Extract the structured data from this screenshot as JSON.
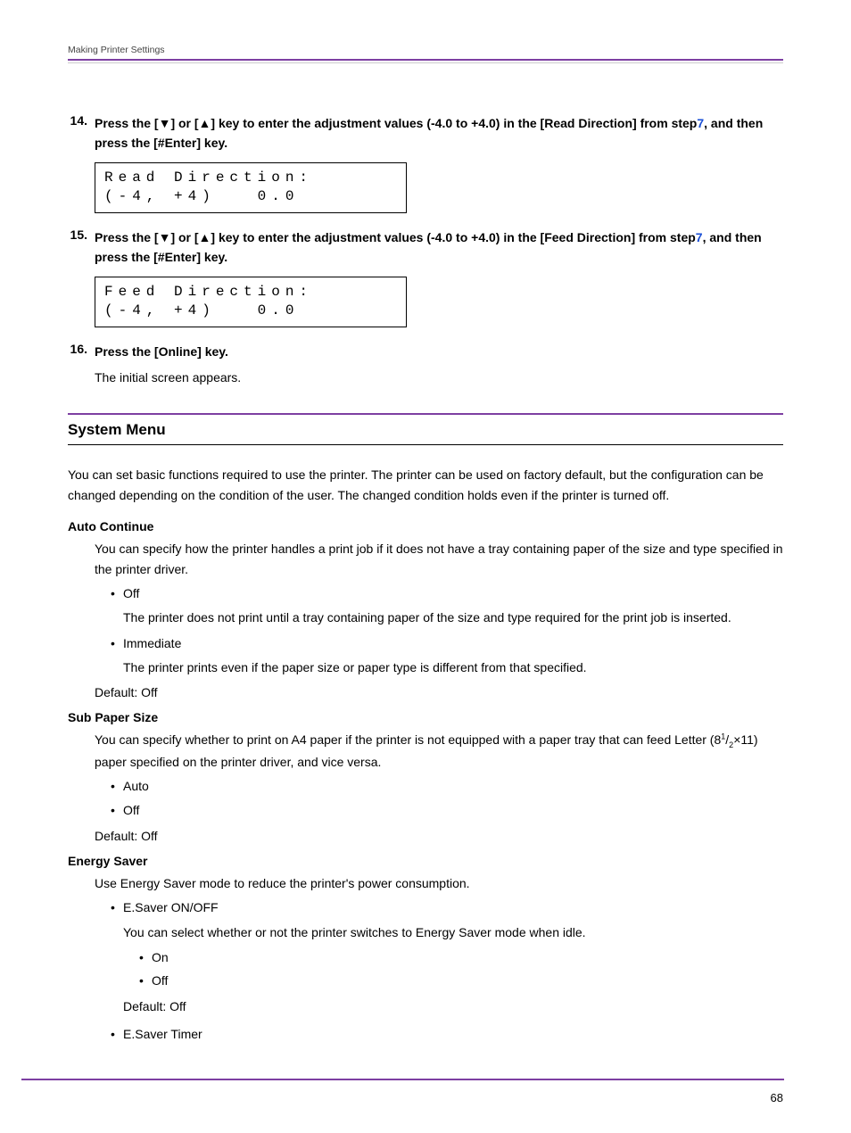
{
  "header": {
    "breadcrumb": "Making Printer Settings"
  },
  "steps": [
    {
      "num": "14.",
      "pre": "Press the [▼] or [▲] key to enter the adjustment values (-4.0 to +4.0) in the [Read Direction] from step",
      "link": "7",
      "post": ", and then press the [#Enter] key.",
      "display_l1": "Read Direction:",
      "display_l2": "(-4, +4)   0.0"
    },
    {
      "num": "15.",
      "pre": "Press the [▼] or [▲] key to enter the adjustment values (-4.0 to +4.0) in the [Feed Direction] from step",
      "link": "7",
      "post": ", and then press the [#Enter] key.",
      "display_l1": "Feed Direction:",
      "display_l2": "(-4, +4)   0.0"
    },
    {
      "num": "16.",
      "pre": "Press the [Online] key.",
      "link": "",
      "post": "",
      "sub": "The initial screen appears."
    }
  ],
  "section": {
    "title": "System Menu"
  },
  "intro": "You can set basic functions required to use the printer. The printer can be used on factory default, but the configuration can be changed depending on the condition of the user. The changed condition holds even if the printer is turned off.",
  "settings": {
    "auto_continue": {
      "title": "Auto Continue",
      "desc": "You can specify how the printer handles a print job if it does not have a tray containing paper of the size and type specified in the printer driver.",
      "opt1_label": "Off",
      "opt1_desc": "The printer does not print until a tray containing paper of the size and type required for the print job is inserted.",
      "opt2_label": "Immediate",
      "opt2_desc": "The printer prints even if the paper size or paper type is different from that specified.",
      "default": "Default: Off"
    },
    "sub_paper": {
      "title": "Sub Paper Size",
      "desc_pre": "You can specify whether to print on A4 paper if the printer is not equipped with a paper tray that can feed Letter (8",
      "desc_post": "×11) paper specified on the printer driver, and vice versa.",
      "opt1": "Auto",
      "opt2": "Off",
      "default": "Default: Off"
    },
    "energy": {
      "title": "Energy Saver",
      "desc": "Use Energy Saver mode to reduce the printer's power consumption.",
      "opt1_label": "E.Saver ON/OFF",
      "opt1_desc": "You can select whether or not the printer switches to Energy Saver mode when idle.",
      "nested1": "On",
      "nested2": "Off",
      "default": "Default: Off",
      "opt2_label": "E.Saver Timer"
    }
  },
  "footer": {
    "page": "68"
  }
}
